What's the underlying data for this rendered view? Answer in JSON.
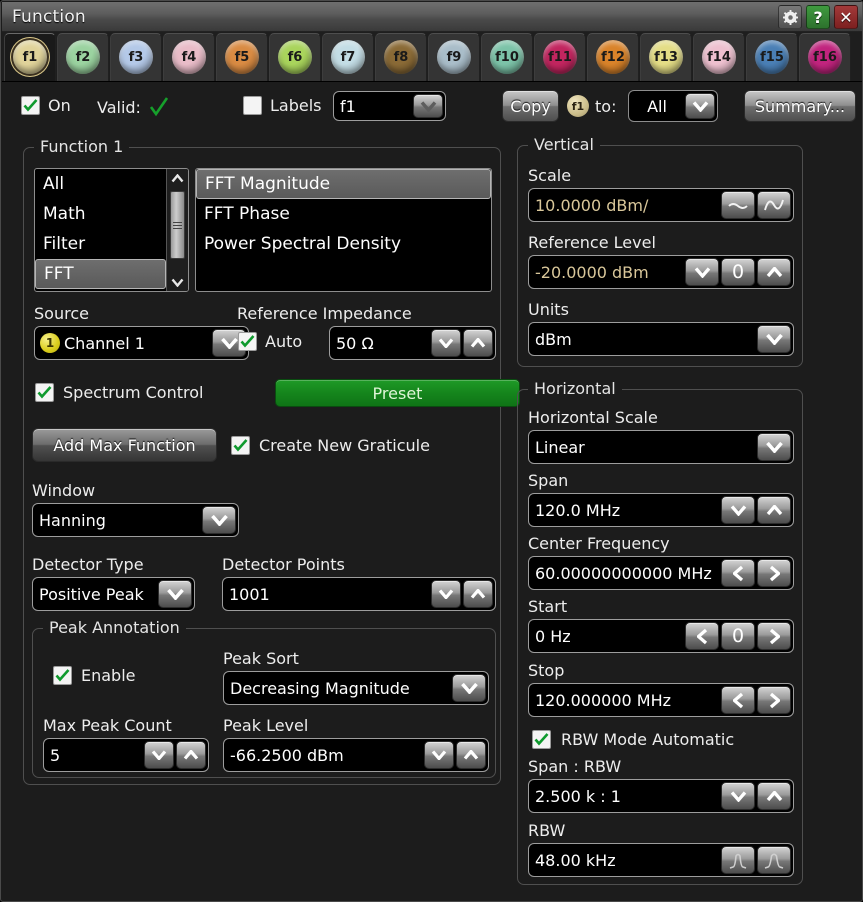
{
  "window": {
    "title": "Function",
    "buttons": [
      {
        "name": "settings",
        "icon": "gear-icon",
        "label": "⚙"
      },
      {
        "name": "help",
        "icon": "question-icon",
        "label": "?"
      },
      {
        "name": "close",
        "icon": "close-icon",
        "label": "✕"
      }
    ]
  },
  "tabs": [
    {
      "label": "f1",
      "color": "#e0d39a",
      "selected": true
    },
    {
      "label": "f2",
      "color": "#9bd3a0",
      "selected": false
    },
    {
      "label": "f3",
      "color": "#b4c9e8",
      "selected": false
    },
    {
      "label": "f4",
      "color": "#e9bcc8",
      "selected": false
    },
    {
      "label": "f5",
      "color": "#d98b43",
      "selected": false
    },
    {
      "label": "f6",
      "color": "#a9d45c",
      "selected": false
    },
    {
      "label": "f7",
      "color": "#c3dde5",
      "selected": false
    },
    {
      "label": "f8",
      "color": "#8a6a36",
      "selected": false
    },
    {
      "label": "f9",
      "color": "#a9bdc9",
      "selected": false
    },
    {
      "label": "f10",
      "color": "#7cc3a8",
      "selected": false
    },
    {
      "label": "f11",
      "color": "#c2255f",
      "selected": false
    },
    {
      "label": "f12",
      "color": "#d9832a",
      "selected": false
    },
    {
      "label": "f13",
      "color": "#e4dd86",
      "selected": false
    },
    {
      "label": "f14",
      "color": "#eec0cf",
      "selected": false
    },
    {
      "label": "f15",
      "color": "#4a7fb5",
      "selected": false
    },
    {
      "label": "f16",
      "color": "#c1247e",
      "selected": false
    }
  ],
  "controlbar": {
    "on_label": "On",
    "on_checked": true,
    "valid_label": "Valid:",
    "valid_mark": "✓",
    "labels_label": "Labels",
    "labels_checked": false,
    "labels_value": "f1",
    "copy_label": "Copy",
    "copy_source": "f1",
    "to_label": "to:",
    "to_value": "All",
    "summary_label": "Summary..."
  },
  "function_group": {
    "title": "Function 1",
    "categories": [
      "All",
      "Math",
      "Filter",
      "FFT"
    ],
    "selected_category": "FFT",
    "operations": [
      "FFT Magnitude",
      "FFT Phase",
      "Power Spectral Density"
    ],
    "selected_operation": "FFT Magnitude",
    "source_label": "Source",
    "source_channel_number": "1",
    "source_value": "Channel 1",
    "ref_impedance_label": "Reference Impedance",
    "auto_label": "Auto",
    "auto_checked": true,
    "impedance_value": "50 Ω",
    "spectrum_control_label": "Spectrum Control",
    "spectrum_control_checked": true,
    "preset_label": "Preset",
    "add_max_function_label": "Add Max Function",
    "create_new_graticule_label": "Create New Graticule",
    "create_new_graticule_checked": true,
    "window_label": "Window",
    "window_value": "Hanning",
    "detector_type_label": "Detector Type",
    "detector_type_value": "Positive Peak",
    "detector_points_label": "Detector Points",
    "detector_points_value": "1001"
  },
  "peak_annotation": {
    "title": "Peak Annotation",
    "enable_label": "Enable",
    "enable_checked": true,
    "peak_sort_label": "Peak Sort",
    "peak_sort_value": "Decreasing Magnitude",
    "max_peak_count_label": "Max Peak Count",
    "max_peak_count_value": "5",
    "peak_level_label": "Peak Level",
    "peak_level_value": "-66.2500 dBm"
  },
  "vertical": {
    "title": "Vertical",
    "scale_label": "Scale",
    "scale_value": "10.0000 dBm/",
    "reference_level_label": "Reference Level",
    "reference_level_value": "-20.0000 dBm",
    "reference_zero_button": "0",
    "units_label": "Units",
    "units_value": "dBm"
  },
  "horizontal": {
    "title": "Horizontal",
    "horizontal_scale_label": "Horizontal Scale",
    "horizontal_scale_value": "Linear",
    "span_label": "Span",
    "span_value": "120.0 MHz",
    "center_frequency_label": "Center Frequency",
    "center_frequency_value": "60.00000000000 MHz",
    "start_label": "Start",
    "start_value": "0 Hz",
    "start_zero_button": "0",
    "stop_label": "Stop",
    "stop_value": "120.000000 MHz",
    "rbw_mode_automatic_label": "RBW Mode Automatic",
    "rbw_mode_automatic_checked": true,
    "span_rbw_label": "Span : RBW",
    "span_rbw_value": "2.500 k : 1",
    "rbw_label": "RBW",
    "rbw_value": "48.00 kHz"
  },
  "colors": {
    "accent_green": "#18911f",
    "value_tan": "#d9c79a",
    "check_green": "#0f9a2e",
    "background": "#1c1c1c"
  }
}
